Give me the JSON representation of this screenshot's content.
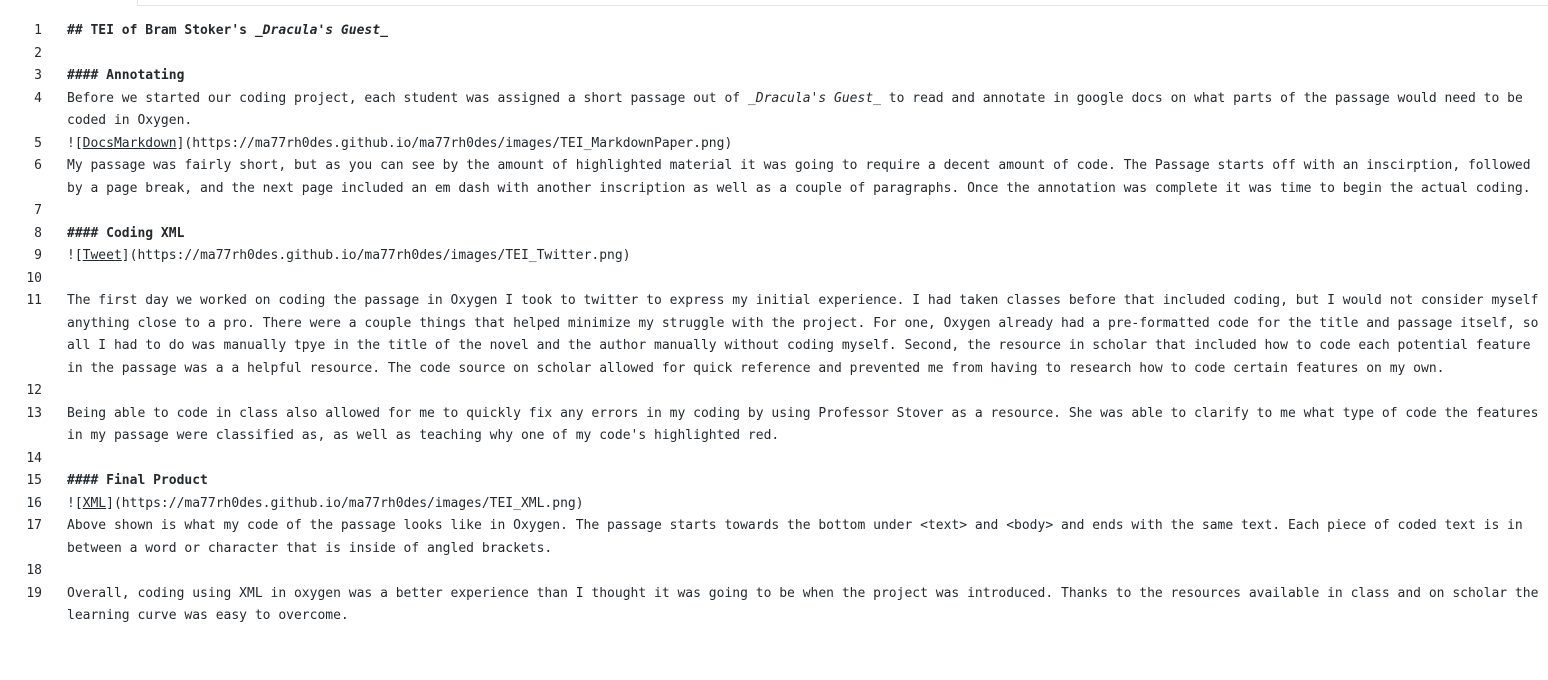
{
  "lines": [
    {
      "n": "1",
      "parts": [
        {
          "t": "## TEI of Bram Stoker's ",
          "s": "heading"
        },
        {
          "t": "_Dracula's Guest_",
          "s": "heading ital"
        }
      ]
    },
    {
      "n": "2",
      "parts": []
    },
    {
      "n": "3",
      "parts": [
        {
          "t": "#### Annotating",
          "s": "heading"
        }
      ]
    },
    {
      "n": "4",
      "parts": [
        {
          "t": "Before we started our coding project, each student was assigned a short passage out of "
        },
        {
          "t": "_Dracula's Guest_",
          "s": "ital"
        },
        {
          "t": " to read and annotate in google docs on what parts of the passage would need to be coded in Oxygen."
        }
      ]
    },
    {
      "n": "5",
      "parts": [
        {
          "t": "!["
        },
        {
          "t": "DocsMarkdown",
          "s": "link-text"
        },
        {
          "t": "](https://ma77rh0des.github.io/ma77rh0des/images/TEI_MarkdownPaper.png)"
        }
      ]
    },
    {
      "n": "6",
      "parts": [
        {
          "t": "My passage was fairly short, but as you can see by the amount of highlighted material it was going to require a decent amount of code. The Passage starts off with an inscirption, followed by a page break, and the next page included an em dash with another inscription as well as a couple of paragraphs. Once the annotation was complete it was time to begin the actual coding."
        }
      ]
    },
    {
      "n": "7",
      "parts": []
    },
    {
      "n": "8",
      "parts": [
        {
          "t": "#### Coding XML",
          "s": "heading"
        }
      ]
    },
    {
      "n": "9",
      "parts": [
        {
          "t": "!["
        },
        {
          "t": "Tweet",
          "s": "link-text"
        },
        {
          "t": "](https://ma77rh0des.github.io/ma77rh0des/images/TEI_Twitter.png)"
        }
      ]
    },
    {
      "n": "10",
      "parts": []
    },
    {
      "n": "11",
      "parts": [
        {
          "t": "The first day we worked on coding the passage in Oxygen I took to twitter to express my initial experience. I had taken classes before that included coding, but I would not consider myself anything close to a pro. There were a couple things that helped minimize my struggle with the project. For one, Oxygen already had a pre-formatted code for the title and passage itself, so all I had to do was manually tpye in the title of the novel and the author manually without coding myself. Second, the resource in scholar that included how to code each potential feature in the passage was a a helpful resource. The code source on scholar allowed for quick reference and prevented me from having to research how to code certain features on my own."
        }
      ]
    },
    {
      "n": "12",
      "parts": []
    },
    {
      "n": "13",
      "parts": [
        {
          "t": "Being able to code in class also allowed for me to quickly fix any errors in my coding by using Professor Stover as a resource. She was able to clarify to me what type of code the features in my passage were classified as, as well as teaching why one of my code's highlighted red."
        }
      ]
    },
    {
      "n": "14",
      "parts": []
    },
    {
      "n": "15",
      "parts": [
        {
          "t": "#### Final Product",
          "s": "heading"
        }
      ]
    },
    {
      "n": "16",
      "parts": [
        {
          "t": "!["
        },
        {
          "t": "XML",
          "s": "link-text"
        },
        {
          "t": "](https://ma77rh0des.github.io/ma77rh0des/images/TEI_XML.png)"
        }
      ]
    },
    {
      "n": "17",
      "parts": [
        {
          "t": "Above shown is what my code of the passage looks like in Oxygen. The passage starts towards the bottom under <text> and <body> and ends with the same text. Each piece of coded text is in between a word or character that is inside of angled brackets."
        }
      ]
    },
    {
      "n": "18",
      "parts": []
    },
    {
      "n": "19",
      "parts": [
        {
          "t": "Overall, coding using XML in oxygen was a better experience than I thought it was going to be when the project was introduced. Thanks to the resources available in class and on scholar the learning curve was easy to overcome."
        }
      ]
    }
  ]
}
